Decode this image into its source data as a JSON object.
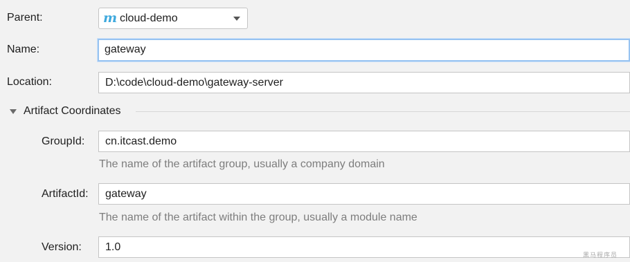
{
  "form": {
    "parent": {
      "label": "Parent:",
      "icon": "maven-m-icon",
      "icon_glyph": "m",
      "value": "cloud-demo"
    },
    "name": {
      "label": "Name:",
      "value": "gateway"
    },
    "location": {
      "label": "Location:",
      "value": "D:\\code\\cloud-demo\\gateway-server"
    },
    "artifact_coordinates": {
      "title": "Artifact Coordinates",
      "expanded": true,
      "group_id": {
        "label": "GroupId:",
        "value": "cn.itcast.demo",
        "hint": "The name of the artifact group, usually a company domain"
      },
      "artifact_id": {
        "label": "ArtifactId:",
        "value": "gateway",
        "hint": "The name of the artifact within the group, usually a module name"
      },
      "version": {
        "label": "Version:",
        "value": "1.0"
      }
    }
  },
  "watermark": "黑马程序员",
  "colors": {
    "background": "#f2f2f2",
    "focus_border": "#97c3f1",
    "maven_icon": "#3fa9dd",
    "hint_text": "#7d7d7d"
  }
}
